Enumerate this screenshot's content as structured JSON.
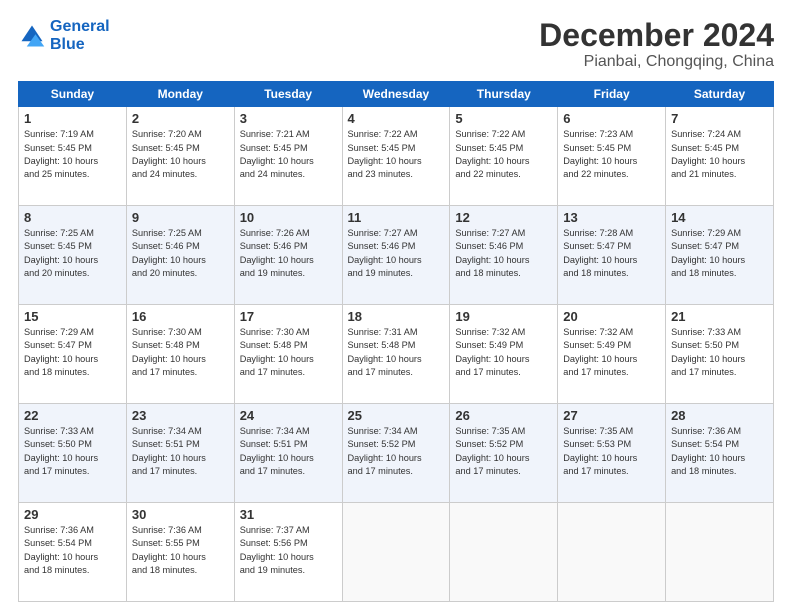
{
  "logo": {
    "line1": "General",
    "line2": "Blue"
  },
  "title": "December 2024",
  "subtitle": "Pianbai, Chongqing, China",
  "weekdays": [
    "Sunday",
    "Monday",
    "Tuesday",
    "Wednesday",
    "Thursday",
    "Friday",
    "Saturday"
  ],
  "weeks": [
    [
      {
        "day": "1",
        "info": "Sunrise: 7:19 AM\nSunset: 5:45 PM\nDaylight: 10 hours\nand 25 minutes."
      },
      {
        "day": "2",
        "info": "Sunrise: 7:20 AM\nSunset: 5:45 PM\nDaylight: 10 hours\nand 24 minutes."
      },
      {
        "day": "3",
        "info": "Sunrise: 7:21 AM\nSunset: 5:45 PM\nDaylight: 10 hours\nand 24 minutes."
      },
      {
        "day": "4",
        "info": "Sunrise: 7:22 AM\nSunset: 5:45 PM\nDaylight: 10 hours\nand 23 minutes."
      },
      {
        "day": "5",
        "info": "Sunrise: 7:22 AM\nSunset: 5:45 PM\nDaylight: 10 hours\nand 22 minutes."
      },
      {
        "day": "6",
        "info": "Sunrise: 7:23 AM\nSunset: 5:45 PM\nDaylight: 10 hours\nand 22 minutes."
      },
      {
        "day": "7",
        "info": "Sunrise: 7:24 AM\nSunset: 5:45 PM\nDaylight: 10 hours\nand 21 minutes."
      }
    ],
    [
      {
        "day": "8",
        "info": "Sunrise: 7:25 AM\nSunset: 5:45 PM\nDaylight: 10 hours\nand 20 minutes."
      },
      {
        "day": "9",
        "info": "Sunrise: 7:25 AM\nSunset: 5:46 PM\nDaylight: 10 hours\nand 20 minutes."
      },
      {
        "day": "10",
        "info": "Sunrise: 7:26 AM\nSunset: 5:46 PM\nDaylight: 10 hours\nand 19 minutes."
      },
      {
        "day": "11",
        "info": "Sunrise: 7:27 AM\nSunset: 5:46 PM\nDaylight: 10 hours\nand 19 minutes."
      },
      {
        "day": "12",
        "info": "Sunrise: 7:27 AM\nSunset: 5:46 PM\nDaylight: 10 hours\nand 18 minutes."
      },
      {
        "day": "13",
        "info": "Sunrise: 7:28 AM\nSunset: 5:47 PM\nDaylight: 10 hours\nand 18 minutes."
      },
      {
        "day": "14",
        "info": "Sunrise: 7:29 AM\nSunset: 5:47 PM\nDaylight: 10 hours\nand 18 minutes."
      }
    ],
    [
      {
        "day": "15",
        "info": "Sunrise: 7:29 AM\nSunset: 5:47 PM\nDaylight: 10 hours\nand 18 minutes."
      },
      {
        "day": "16",
        "info": "Sunrise: 7:30 AM\nSunset: 5:48 PM\nDaylight: 10 hours\nand 17 minutes."
      },
      {
        "day": "17",
        "info": "Sunrise: 7:30 AM\nSunset: 5:48 PM\nDaylight: 10 hours\nand 17 minutes."
      },
      {
        "day": "18",
        "info": "Sunrise: 7:31 AM\nSunset: 5:48 PM\nDaylight: 10 hours\nand 17 minutes."
      },
      {
        "day": "19",
        "info": "Sunrise: 7:32 AM\nSunset: 5:49 PM\nDaylight: 10 hours\nand 17 minutes."
      },
      {
        "day": "20",
        "info": "Sunrise: 7:32 AM\nSunset: 5:49 PM\nDaylight: 10 hours\nand 17 minutes."
      },
      {
        "day": "21",
        "info": "Sunrise: 7:33 AM\nSunset: 5:50 PM\nDaylight: 10 hours\nand 17 minutes."
      }
    ],
    [
      {
        "day": "22",
        "info": "Sunrise: 7:33 AM\nSunset: 5:50 PM\nDaylight: 10 hours\nand 17 minutes."
      },
      {
        "day": "23",
        "info": "Sunrise: 7:34 AM\nSunset: 5:51 PM\nDaylight: 10 hours\nand 17 minutes."
      },
      {
        "day": "24",
        "info": "Sunrise: 7:34 AM\nSunset: 5:51 PM\nDaylight: 10 hours\nand 17 minutes."
      },
      {
        "day": "25",
        "info": "Sunrise: 7:34 AM\nSunset: 5:52 PM\nDaylight: 10 hours\nand 17 minutes."
      },
      {
        "day": "26",
        "info": "Sunrise: 7:35 AM\nSunset: 5:52 PM\nDaylight: 10 hours\nand 17 minutes."
      },
      {
        "day": "27",
        "info": "Sunrise: 7:35 AM\nSunset: 5:53 PM\nDaylight: 10 hours\nand 17 minutes."
      },
      {
        "day": "28",
        "info": "Sunrise: 7:36 AM\nSunset: 5:54 PM\nDaylight: 10 hours\nand 18 minutes."
      }
    ],
    [
      {
        "day": "29",
        "info": "Sunrise: 7:36 AM\nSunset: 5:54 PM\nDaylight: 10 hours\nand 18 minutes."
      },
      {
        "day": "30",
        "info": "Sunrise: 7:36 AM\nSunset: 5:55 PM\nDaylight: 10 hours\nand 18 minutes."
      },
      {
        "day": "31",
        "info": "Sunrise: 7:37 AM\nSunset: 5:56 PM\nDaylight: 10 hours\nand 19 minutes."
      },
      null,
      null,
      null,
      null
    ]
  ]
}
